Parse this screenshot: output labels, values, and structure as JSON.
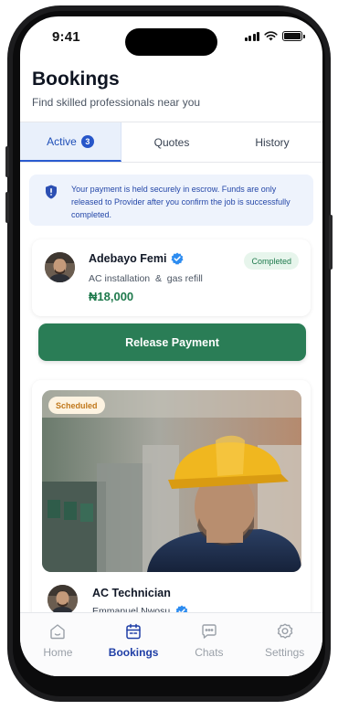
{
  "status_bar": {
    "time": "9:41"
  },
  "header": {
    "title": "Bookings",
    "subtitle": "Find skilled professionals near you"
  },
  "tabs": [
    {
      "label": "Active",
      "badge": "3",
      "active": true
    },
    {
      "label": "Quotes"
    },
    {
      "label": "History"
    }
  ],
  "escrow_notice": "Your payment is held securely in escrow. Funds are only released to Provider after you confirm the job is successfully completed.",
  "booking": {
    "provider_name": "Adebayo Femi",
    "service": "AC installation  &  gas refill",
    "price": "₦18,000",
    "status": "Completed",
    "action_label": "Release Payment"
  },
  "scheduled_booking": {
    "status": "Scheduled",
    "title": "AC Technician",
    "provider_name": "Emmanuel Nwosu"
  },
  "bottom_nav": [
    {
      "label": "Home",
      "icon": "home-icon"
    },
    {
      "label": "Bookings",
      "icon": "calendar-icon",
      "active": true
    },
    {
      "label": "Chats",
      "icon": "chat-icon"
    },
    {
      "label": "Settings",
      "icon": "gear-icon"
    }
  ],
  "colors": {
    "primary_blue": "#2756c9",
    "success_green": "#2a7d56",
    "escrow_bg": "#eef3fc",
    "scheduled_text": "#c0781b"
  }
}
